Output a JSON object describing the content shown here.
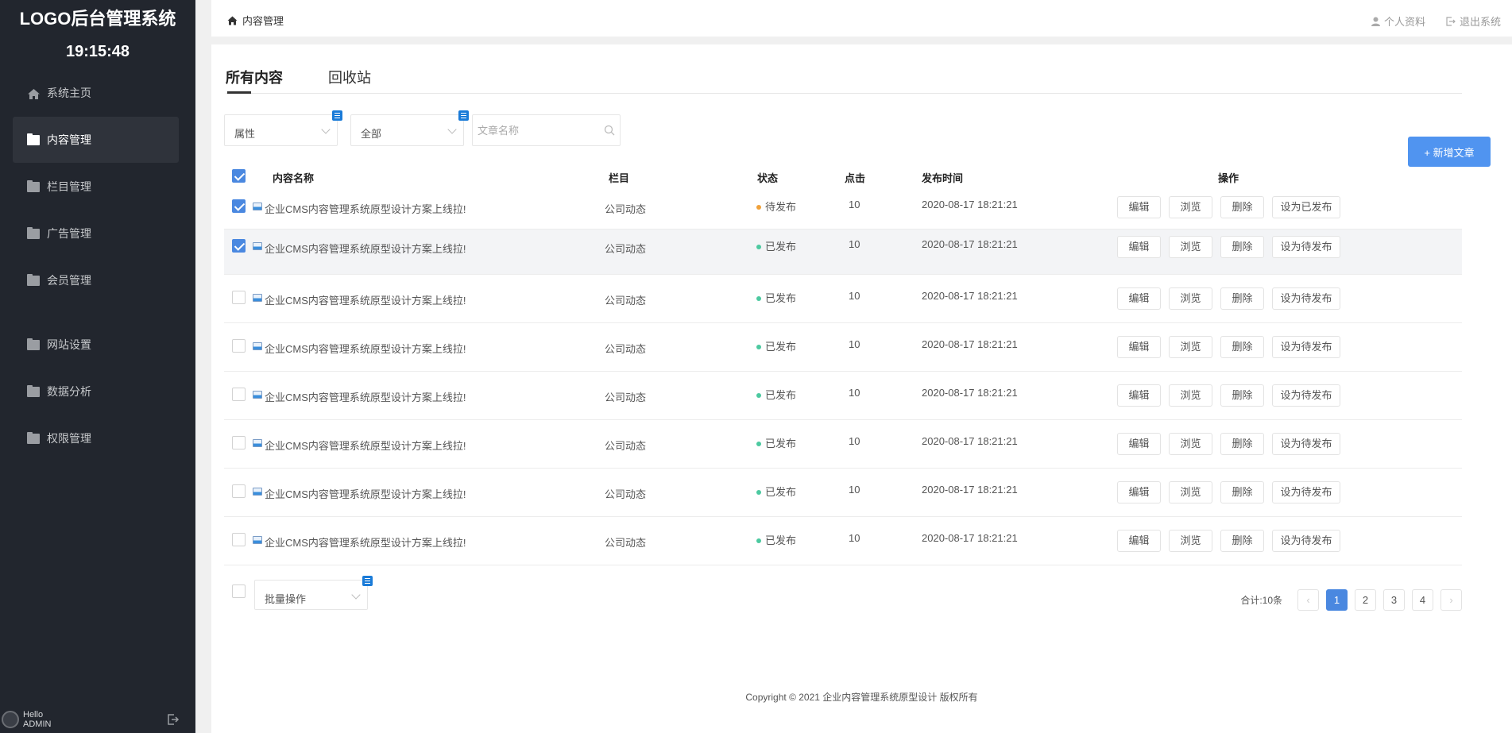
{
  "sidebar": {
    "logo": "LOGO后台管理系统",
    "clock": "19:15:48",
    "items": [
      {
        "label": "系统主页",
        "icon": "home-icon"
      },
      {
        "label": "内容管理",
        "icon": "folder-icon"
      },
      {
        "label": "栏目管理",
        "icon": "folder-icon"
      },
      {
        "label": "广告管理",
        "icon": "folder-icon"
      },
      {
        "label": "会员管理",
        "icon": "folder-icon"
      },
      {
        "label": "网站设置",
        "icon": "folder-icon"
      },
      {
        "label": "数据分析",
        "icon": "folder-icon"
      },
      {
        "label": "权限管理",
        "icon": "folder-icon"
      }
    ],
    "user": {
      "hello": "Hello",
      "name": "ADMIN"
    }
  },
  "header": {
    "breadcrumb": "内容管理",
    "profile": "个人资料",
    "logout": "退出系统"
  },
  "tabs": [
    "所有内容",
    "回收站"
  ],
  "filters": {
    "attr": "属性",
    "category": "全部",
    "search_placeholder": "文章名称"
  },
  "add_button": "+ 新增文章",
  "table": {
    "headers": {
      "name": "内容名称",
      "column": "栏目",
      "status": "状态",
      "clicks": "点击",
      "time": "发布时间",
      "ops": "操作"
    },
    "ops": {
      "edit": "编辑",
      "view": "浏览",
      "delete": "删除"
    },
    "rows": [
      {
        "title": "企业CMS内容管理系统原型设计方案上线拉!",
        "column": "公司动态",
        "status": "待发布",
        "clicks": "10",
        "time": "2020-08-17 18:21:21",
        "toggle": "设为已发布",
        "checked": true
      },
      {
        "title": "企业CMS内容管理系统原型设计方案上线拉!",
        "column": "公司动态",
        "status": "已发布",
        "clicks": "10",
        "time": "2020-08-17 18:21:21",
        "toggle": "设为待发布",
        "checked": true
      },
      {
        "title": "企业CMS内容管理系统原型设计方案上线拉!",
        "column": "公司动态",
        "status": "已发布",
        "clicks": "10",
        "time": "2020-08-17 18:21:21",
        "toggle": "设为待发布",
        "checked": false
      },
      {
        "title": "企业CMS内容管理系统原型设计方案上线拉!",
        "column": "公司动态",
        "status": "已发布",
        "clicks": "10",
        "time": "2020-08-17 18:21:21",
        "toggle": "设为待发布",
        "checked": false
      },
      {
        "title": "企业CMS内容管理系统原型设计方案上线拉!",
        "column": "公司动态",
        "status": "已发布",
        "clicks": "10",
        "time": "2020-08-17 18:21:21",
        "toggle": "设为待发布",
        "checked": false
      },
      {
        "title": "企业CMS内容管理系统原型设计方案上线拉!",
        "column": "公司动态",
        "status": "已发布",
        "clicks": "10",
        "time": "2020-08-17 18:21:21",
        "toggle": "设为待发布",
        "checked": false
      },
      {
        "title": "企业CMS内容管理系统原型设计方案上线拉!",
        "column": "公司动态",
        "status": "已发布",
        "clicks": "10",
        "time": "2020-08-17 18:21:21",
        "toggle": "设为待发布",
        "checked": false
      },
      {
        "title": "企业CMS内容管理系统原型设计方案上线拉!",
        "column": "公司动态",
        "status": "已发布",
        "clicks": "10",
        "time": "2020-08-17 18:21:21",
        "toggle": "设为待发布",
        "checked": false
      }
    ]
  },
  "batch": "批量操作",
  "pagination": {
    "total": "合计:10条",
    "pages": [
      "1",
      "2",
      "3",
      "4"
    ],
    "current": "1"
  },
  "copyright": "Copyright © 2021 企业内容管理系统原型设计 版权所有",
  "colors": {
    "accent": "#4a88e0",
    "pending": "#f0a13a",
    "published": "#4cc9a0",
    "sidebar": "#22262e"
  }
}
